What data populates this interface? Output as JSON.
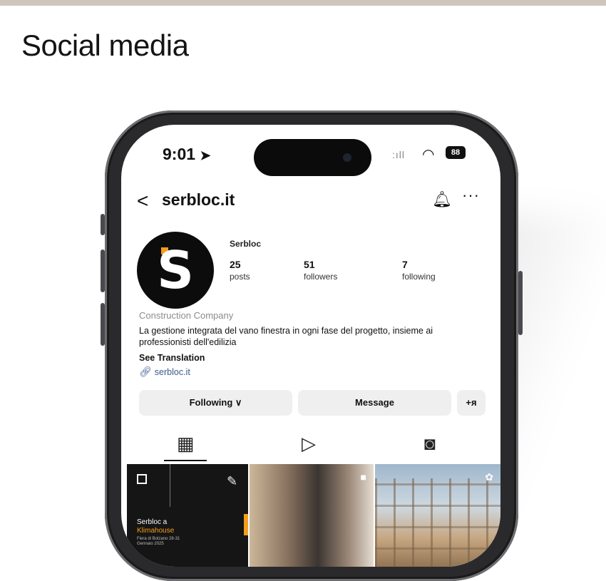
{
  "page": {
    "heading": "Social media"
  },
  "phone": {
    "status": {
      "time": "9:01",
      "battery": "88"
    },
    "nav": {
      "back": "<",
      "handle": "serbloc.it",
      "more": "···"
    },
    "profile": {
      "name": "Serbloc",
      "stats": [
        {
          "value": "25",
          "label": "posts"
        },
        {
          "value": "51",
          "label": "followers"
        },
        {
          "value": "7",
          "label": "following"
        }
      ],
      "category": "Construction Company",
      "bio": "La gestione integrata del vano finestra in ogni fase del progetto, insieme ai professionisti dell'edilizia",
      "see_translation": "See Translation",
      "link": "serbloc.it"
    },
    "actions": {
      "following": "Following ∨",
      "message": "Message",
      "add_person": "+ᴙ"
    },
    "grid": {
      "post1_title": "Serbloc a",
      "post1_title2": "Klimahouse",
      "post1_sub": "Fiera di Bolzano 28-31 Gennaio 2025"
    }
  }
}
